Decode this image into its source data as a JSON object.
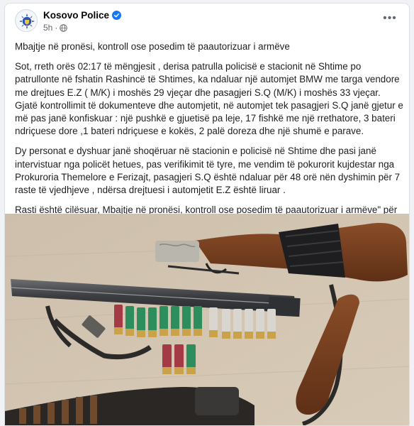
{
  "post": {
    "author": "Kosovo Police",
    "time": "5h",
    "verified_icon": "verified-badge-icon",
    "privacy_icon": "globe-icon",
    "more_icon": "more-options-icon",
    "more_label": "•••",
    "paragraphs": [
      "Mbajtje në pronësi, kontroll ose posedim të paautorizuar i armëve",
      "Sot, rreth orës 02:17 të mëngjesit , derisa patrulla policisë e stacionit në Shtime po patrullonte në fshatin Rashincë të Shtimes, ka ndaluar një automjet BMW me targa vendore me drejtues E.Z ( M/K) i moshës 29 vjeçar dhe pasagjeri S.Q (M/K) i moshës 33 vjeçar. Gjatë kontrollimit të dokumenteve dhe automjetit, në automjet tek pasagjeri S.Q janë gjetur e më pas janë konfiskuar : një pushkë e gjuetisë pa leje, 17 fishkë me një rrethatore, 3 bateri ndriçuese dore ,1 bateri ndriçuese e kokës, 2 palë doreza dhe një shumë e parave.",
      "Dy personat e dyshuar janë shoqëruar në stacionin e policisë në Shtime dhe pasi janë intervistuar nga policët hetues, pas verifikimit të tyre, me vendim të pokurorit kujdestar nga Prokuroria Themelore e Ferizajt, pasagjeri S.Q është ndaluar për 48 orë nën dyshimin për 7 raste të vjedhjeve , ndërsa drejtuesi i automjetit E.Z është liruar .",
      "Rasti është cilësuar, Mbajtje në pronësi, kontroll ose posedim të paautorizuar i armëve\" për procedura të mëtejme hetimore."
    ]
  },
  "colors": {
    "verified": "#1877f2",
    "meta_text": "#65676b",
    "body_text": "#1c1e21",
    "table_surface": "#cdbfab"
  }
}
